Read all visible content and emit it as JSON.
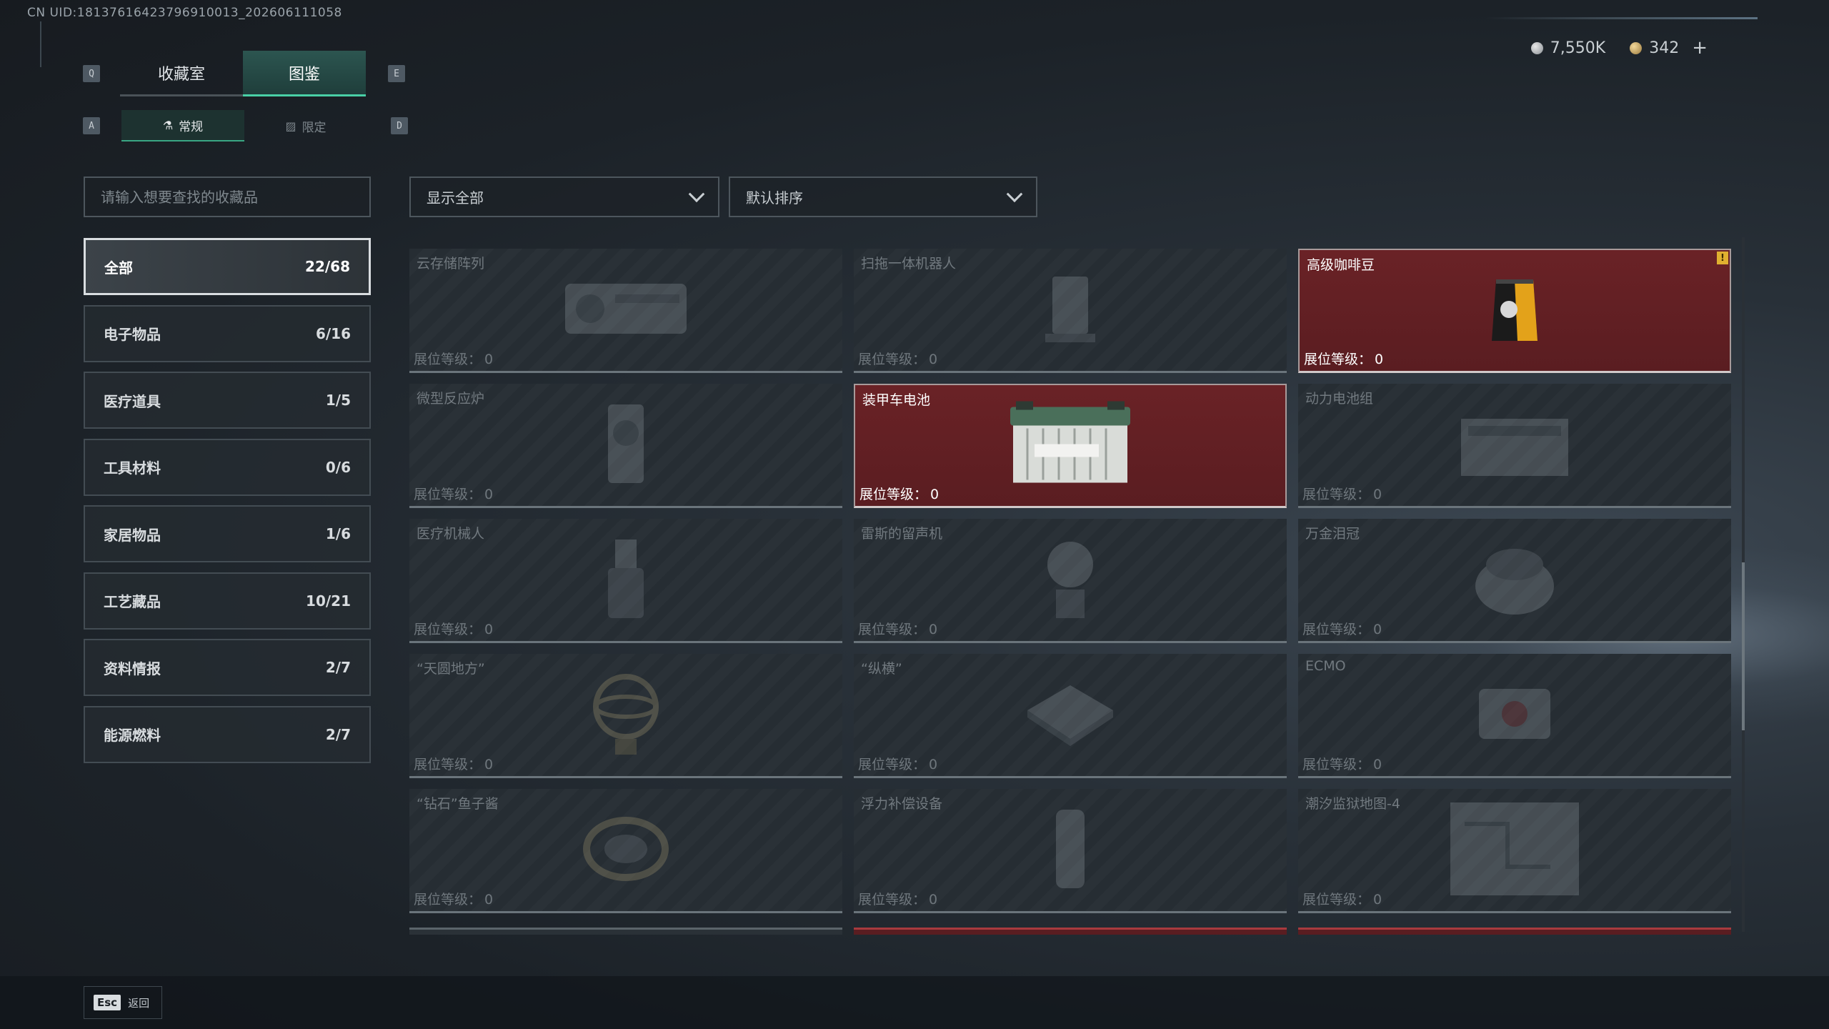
{
  "uid": "CN UID:18137616423796910013_202606111058",
  "currency": {
    "silver": "7,550K",
    "gold": "342",
    "add": "+"
  },
  "keys": {
    "q": "Q",
    "e": "E",
    "a": "A",
    "d": "D"
  },
  "main_tabs": [
    {
      "label": "收藏室"
    },
    {
      "label": "图鉴"
    }
  ],
  "sub_tabs": [
    {
      "label": "常规",
      "icon": "flask-icon"
    },
    {
      "label": "限定",
      "icon": "image-icon"
    }
  ],
  "search": {
    "placeholder": "请输入想要查找的收藏品"
  },
  "filter": {
    "selected": "显示全部"
  },
  "sort": {
    "selected": "默认排序"
  },
  "categories": [
    {
      "label": "全部",
      "count": "22/68"
    },
    {
      "label": "电子物品",
      "count": "6/16"
    },
    {
      "label": "医疗道具",
      "count": "1/5"
    },
    {
      "label": "工具材料",
      "count": "0/6"
    },
    {
      "label": "家居物品",
      "count": "1/6"
    },
    {
      "label": "工艺藏品",
      "count": "10/21"
    },
    {
      "label": "资料情报",
      "count": "2/7"
    },
    {
      "label": "能源燃料",
      "count": "2/7"
    }
  ],
  "level_label": "展位等级：",
  "items": [
    {
      "name": "云存储阵列",
      "level": "0",
      "owned": false
    },
    {
      "name": "扫拖一体机器人",
      "level": "0",
      "owned": false
    },
    {
      "name": "高级咖啡豆",
      "level": "0",
      "owned": true,
      "badge": "!"
    },
    {
      "name": "微型反应炉",
      "level": "0",
      "owned": false
    },
    {
      "name": "装甲车电池",
      "level": "0",
      "owned": true
    },
    {
      "name": "动力电池组",
      "level": "0",
      "owned": false
    },
    {
      "name": "医疗机械人",
      "level": "0",
      "owned": false
    },
    {
      "name": "雷斯的留声机",
      "level": "0",
      "owned": false
    },
    {
      "name": "万金泪冠",
      "level": "0",
      "owned": false
    },
    {
      "name": "“天圆地方”",
      "level": "0",
      "owned": false
    },
    {
      "name": "“纵横”",
      "level": "0",
      "owned": false
    },
    {
      "name": "ECMO",
      "level": "0",
      "owned": false
    },
    {
      "name": "“钻石”鱼子酱",
      "level": "0",
      "owned": false
    },
    {
      "name": "浮力补偿设备",
      "level": "0",
      "owned": false
    },
    {
      "name": "潮汐监狱地图-4",
      "level": "0",
      "owned": false
    }
  ],
  "footer": {
    "esc_key": "Esc",
    "back_label": "返回"
  },
  "colors": {
    "accent": "#49d0a6",
    "owned_card": "#5a1d21",
    "badge": "#e0b030"
  }
}
